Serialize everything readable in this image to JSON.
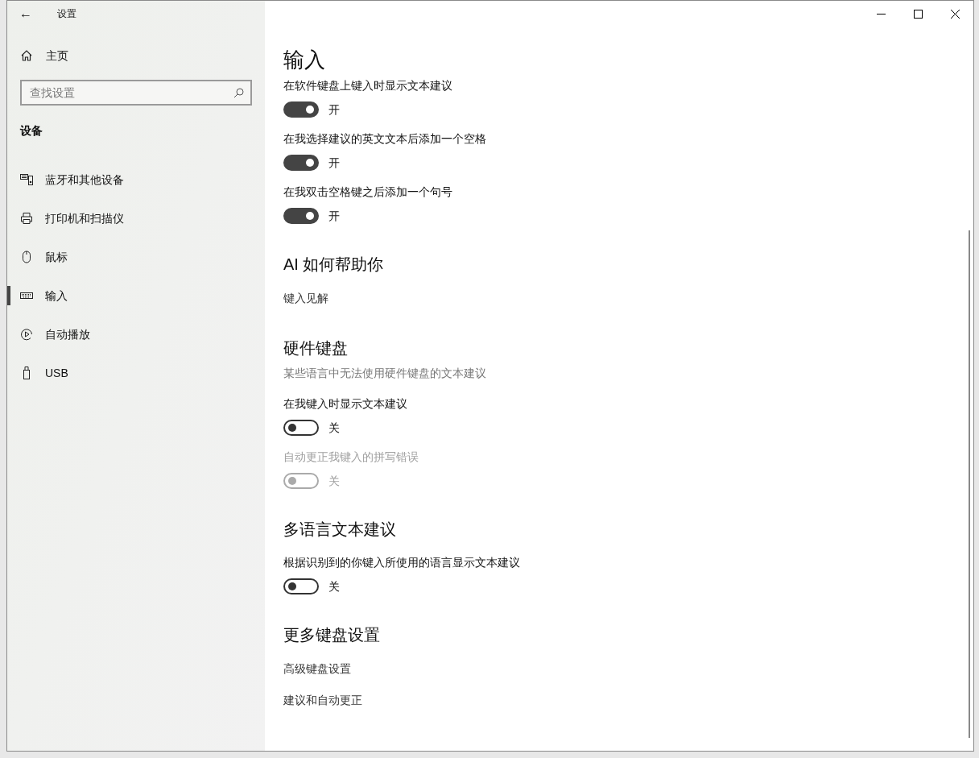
{
  "window": {
    "title": "设置",
    "back_button": "←"
  },
  "sidebar": {
    "home": "主页",
    "search": {
      "placeholder": "查找设置"
    },
    "section": "设备",
    "items": [
      {
        "label": "蓝牙和其他设备",
        "selected": false
      },
      {
        "label": "打印机和扫描仪",
        "selected": false
      },
      {
        "label": "鼠标",
        "selected": false
      },
      {
        "label": "输入",
        "selected": true
      },
      {
        "label": "自动播放",
        "selected": false
      },
      {
        "label": "USB",
        "selected": false
      }
    ]
  },
  "main": {
    "title": "输入",
    "items": [
      {
        "kind": "label",
        "text": "在软件键盘上键入时显示文本建议",
        "disabled": false
      },
      {
        "kind": "toggle",
        "on": true,
        "disabled": false,
        "state_label": "开"
      },
      {
        "kind": "label",
        "text": "在我选择建议的英文文本后添加一个空格",
        "disabled": false
      },
      {
        "kind": "toggle",
        "on": true,
        "disabled": false,
        "state_label": "开"
      },
      {
        "kind": "label",
        "text": "在我双击空格键之后添加一个句号",
        "disabled": false
      },
      {
        "kind": "toggle",
        "on": true,
        "disabled": false,
        "state_label": "开"
      },
      {
        "kind": "heading",
        "text": "AI 如何帮助你"
      },
      {
        "kind": "link",
        "text": "键入见解"
      },
      {
        "kind": "heading",
        "text": "硬件键盘"
      },
      {
        "kind": "description",
        "text": "某些语言中无法使用硬件键盘的文本建议"
      },
      {
        "kind": "label",
        "text": "在我键入时显示文本建议",
        "disabled": false
      },
      {
        "kind": "toggle",
        "on": false,
        "disabled": false,
        "state_label": "关"
      },
      {
        "kind": "label",
        "text": "自动更正我键入的拼写错误",
        "disabled": true
      },
      {
        "kind": "toggle",
        "on": false,
        "disabled": true,
        "state_label": "关"
      },
      {
        "kind": "heading",
        "text": "多语言文本建议"
      },
      {
        "kind": "label",
        "text": "根据识别到的你键入所使用的语言显示文本建议",
        "disabled": false
      },
      {
        "kind": "toggle",
        "on": false,
        "disabled": false,
        "state_label": "关"
      },
      {
        "kind": "heading",
        "text": "更多键盘设置"
      },
      {
        "kind": "link",
        "text": "高级键盘设置"
      },
      {
        "kind": "link",
        "text": "建议和自动更正"
      }
    ]
  }
}
